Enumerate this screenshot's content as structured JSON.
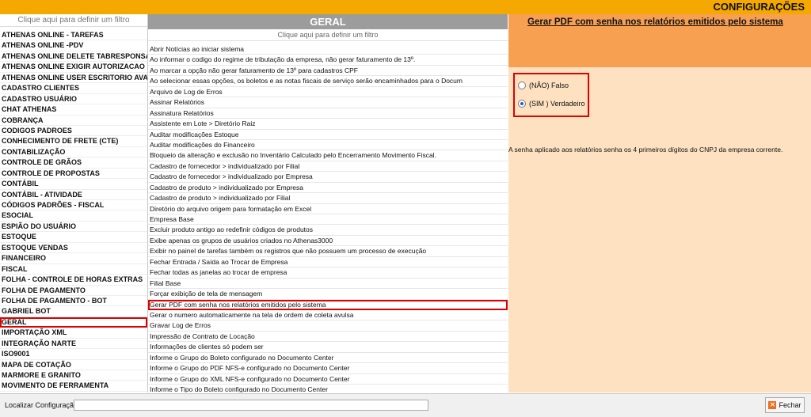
{
  "window": {
    "title": "CONFIGURAÇÕES"
  },
  "left": {
    "filter_text": "Clique aqui para definir um filtro",
    "items": [
      "ATHENAS ONLINE - TAREFAS",
      "ATHENAS ONLINE -PDV",
      "ATHENAS ONLINE DELETE TABRESPONSAV",
      "ATHENAS ONLINE EXIGIR AUTORIZACAO",
      "ATHENAS ONLINE USER ESCRITORIO AVA",
      "CADASTRO CLIENTES",
      "CADASTRO USUÁRIO",
      "CHAT ATHENAS",
      "COBRANÇA",
      "CODIGOS PADROES",
      "CONHECIMENTO DE FRETE (CTE)",
      "CONTABILIZAÇÃO",
      "CONTROLE DE GRÃOS",
      "CONTROLE DE PROPOSTAS",
      "CONTÁBIL",
      "CONTÁBIL - ATIVIDADE",
      "CÓDIGOS PADRÕES - FISCAL",
      "ESOCIAL",
      "ESPIÃO DO USUÁRIO",
      "ESTOQUE",
      "ESTOQUE VENDAS",
      "FINANCEIRO",
      "FISCAL",
      "FOLHA - CONTROLE DE HORAS EXTRAS",
      "FOLHA DE PAGAMENTO",
      "FOLHA DE PAGAMENTO - BOT",
      "GABRIEL BOT",
      "GERAL",
      "IMPORTAÇÃO XML",
      "INTEGRAÇÃO NARTE",
      "ISO9001",
      "MAPA DE COTAÇÃO",
      "MARMORE E GRANITO",
      "MOVIMENTO DE FERRAMENTA"
    ],
    "selected_index": 27
  },
  "middle": {
    "header": "GERAL",
    "filter_text": "Clique aqui para definir um filtro",
    "items": [
      "Abrir Notícias ao iniciar sistema",
      "Ao informar o codigo do regime de tributação da empresa, não gerar faturamento de 13º.",
      "Ao marcar a opção não gerar faturamento de 13º para cadastros CPF",
      "Ao selecionar essas opções, os boletos e as notas fiscais de serviço serão encaminhados para o Docum",
      "Arquivo de Log de Erros",
      "Assinar Relatórios",
      "Assinatura Relatórios",
      "Assistente em Lote > Diretório Raiz",
      "Auditar modificações Estoque",
      "Auditar modificações do Financeiro",
      "Bloqueio da alteração e exclusão no Inventário Calculado pelo Encerramento Movimento Fiscal.",
      "Cadastro de fornecedor > individualizado por Filial",
      "Cadastro de fornecedor > individualizado por Empresa",
      "Cadastro de produto > individualizado por Empresa",
      "Cadastro de produto > individualizado por Filial",
      "Diretório do arquivo origem para formatação em Excel",
      "Empresa Base",
      "Excluir produto antigo ao redefinir códigos de produtos",
      "Exibe apenas os grupos de usuários criados no Athenas3000",
      "Exibir no painel de tarefas também os registros que não possuem um processo de execução",
      "Fechar Entrada / Saída ao Trocar de Empresa",
      "Fechar todas as janelas ao trocar de empresa",
      "Filial Base",
      "Forçar exibição de tela de mensagem",
      "Gerar PDF com senha nos relatórios emitidos pelo sistema",
      "Gerar o numero automaticamente na tela de ordem de coleta avulsa",
      "Gravar Log de Erros",
      "Impressão de Contrato de Locação",
      "Informações de clientes só podem ser",
      "Informe o Grupo do Boleto configurado no Documento Center",
      "Informe o Grupo do PDF NFS-e configurado no Documento Center",
      "Informe o Grupo do XML NFS-e configurado no Documento Center",
      "Informe o Tipo do Boleto configurado no Documento Center"
    ],
    "selected_index": 24
  },
  "right": {
    "title": "Gerar PDF com senha nos relatórios emitidos pelo sistema",
    "option_false": "(NÃO) Falso",
    "option_true": "(SIM ) Verdadeiro",
    "selected": "true",
    "description": "A senha aplicado aos relatórios senha os 4 primeiros dígitos do CNPJ da empresa corrente."
  },
  "bottom": {
    "search_label": "Localizar Configuração:",
    "search_value": "",
    "close_label": "Fechar"
  }
}
